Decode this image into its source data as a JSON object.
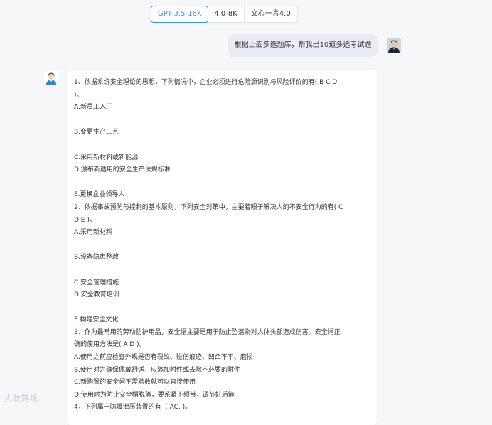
{
  "model_tabs": [
    "GPT-3.5-16K",
    "4.0-8K",
    "文心一言4.0"
  ],
  "user_message": "根据上面多选题库，帮我出10道多选考试题",
  "answer_lines": [
    "1、依据系统安全理论的思想，下列情况中，企业必须进行危险源识别与风险评价的有( B C D",
    ")。",
    "A.新员工入厂",
    "",
    "B.变更生产工艺",
    "",
    "C.采用新材料或新能源",
    "D.颁布新适用的安全生产法规标准",
    "",
    "E.更换企业领导人",
    "2、依据事故预防与控制的基本原则，下列安全对策中，主要着眼于解决人的不安全行为的有( C",
    "D E )。",
    "A.采用新材料",
    "",
    "B.设备隐患整改",
    "",
    "C.安全管理措施",
    "D.安全教育培训",
    "",
    "E.构建安全文化",
    "3、作为最常用的劳动防护用品，安全帽主要是用于防止坠落物对人体头部造成伤害。安全帽正",
    "确的使用方法是( A D )。",
    "A.使用之前应检查外观是否有裂纹、碰伤痕迹、凹凸不平、磨损",
    "B.使用对为确保佩戴舒适，应添加附件或去除不必要的附件",
    "C.新购置的安全帽不需验收就可以直接使用",
    "D.使用时为防止安全帽脱落，要系紧下颏带，调节好后箍",
    "4，下列属于防爆泄压装置的有（ AC. )。"
  ],
  "watermark": "大数跨境"
}
